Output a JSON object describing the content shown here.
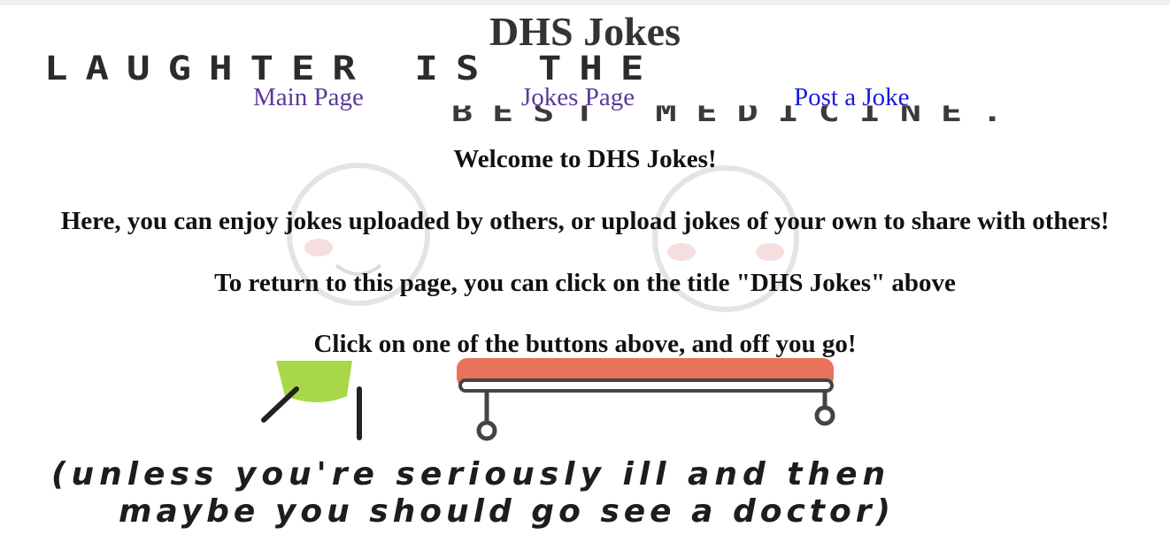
{
  "page": {
    "title": "DHS Jokes"
  },
  "nav": {
    "items": [
      {
        "label": "Main Page"
      },
      {
        "label": "Jokes Page"
      },
      {
        "label": "Post a Joke"
      }
    ]
  },
  "messages": {
    "welcome": "Welcome to DHS Jokes!",
    "intro": "Here, you can enjoy jokes uploaded by others, or upload jokes of your own to share with others!",
    "return_hint": "To return to this page, you can click on the title \"DHS Jokes\" above",
    "cta": "Click on one of the buttons above, and off you go!"
  },
  "background_image": {
    "lines": [
      "LAUGHTER IS THE",
      "BEST MEDICINE.",
      "(unless you're seriously ill and then",
      "maybe you should go see a doctor)"
    ]
  },
  "colors": {
    "visited_link": "#5b3a9a",
    "link": "#1a1ae0",
    "title": "#333333",
    "bed": "#e8735a",
    "figure_green": "#a8d84a"
  }
}
